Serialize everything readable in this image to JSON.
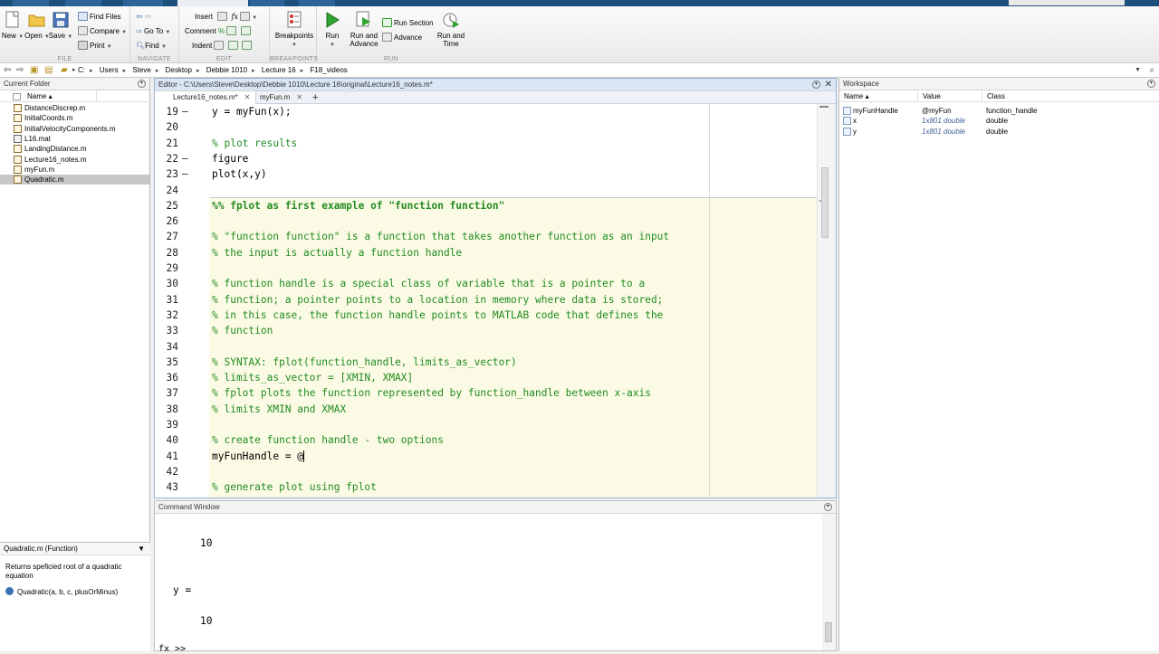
{
  "toolstrip": {
    "file": {
      "section_label": "FILE",
      "new_label": "New",
      "open_label": "Open",
      "save_label": "Save",
      "find_files_label": "Find Files",
      "compare_label": "Compare",
      "print_label": "Print"
    },
    "navigate": {
      "section_label": "NAVIGATE",
      "go_to_label": "Go To",
      "find_label": "Find"
    },
    "edit": {
      "section_label": "EDIT",
      "insert_label": "Insert",
      "comment_label": "Comment",
      "indent_label": "Indent",
      "fx_label": "fx"
    },
    "breakpoints": {
      "section_label": "BREAKPOINTS",
      "breakpoints_label": "Breakpoints"
    },
    "run": {
      "section_label": "RUN",
      "run_label": "Run",
      "run_and_advance_label": "Run and\nAdvance",
      "run_section_label": "Run Section",
      "advance_label": "Advance",
      "run_and_time_label": "Run and\nTime"
    }
  },
  "address_bar": {
    "crumbs": [
      "C:",
      "Users",
      "Steve",
      "Desktop",
      "Debbie 1010",
      "Lecture 16",
      "F18_videos"
    ]
  },
  "current_folder": {
    "title": "Current Folder",
    "column_name": "Name ▴",
    "files": [
      {
        "name": "DistanceDiscrep.m",
        "kind": "m"
      },
      {
        "name": "InitialCoords.m",
        "kind": "m"
      },
      {
        "name": "InitialVelocityComponents.m",
        "kind": "m"
      },
      {
        "name": "L16.mat",
        "kind": "mat"
      },
      {
        "name": "LandingDistance.m",
        "kind": "m"
      },
      {
        "name": "Lecture16_notes.m",
        "kind": "m"
      },
      {
        "name": "myFun.m",
        "kind": "m"
      },
      {
        "name": "Quadratic.m",
        "kind": "m",
        "selected": true
      }
    ],
    "details": {
      "header": "Quadratic.m  (Function)",
      "description": "Returns speficied root of a quadratic equation",
      "signature": "Quadratic(a, b, c, plusOrMinus)"
    }
  },
  "editor": {
    "title": "Editor - C:\\Users\\Steve\\Desktop\\Debbie 1010\\Lecture 16\\original\\Lecture16_notes.m*",
    "tabs": [
      {
        "label": "Lecture16_notes.m*",
        "active": true
      },
      {
        "label": "myFun.m",
        "active": false
      }
    ],
    "add_tab_label": "+",
    "lines": [
      {
        "num": "19",
        "dash": "—",
        "text": "y = myFun(x);",
        "kind": "code"
      },
      {
        "num": "20",
        "dash": "",
        "text": "",
        "kind": "code"
      },
      {
        "num": "21",
        "dash": "",
        "text": "% plot results",
        "kind": "comment"
      },
      {
        "num": "22",
        "dash": "—",
        "text": "figure",
        "kind": "code"
      },
      {
        "num": "23",
        "dash": "—",
        "text": "plot(x,y)",
        "kind": "code"
      },
      {
        "num": "24",
        "dash": "",
        "text": "",
        "kind": "code"
      },
      {
        "num": "25",
        "dash": "",
        "text": "%% fplot as first example of \"function function\"",
        "kind": "cell"
      },
      {
        "num": "26",
        "dash": "",
        "text": "",
        "kind": "code"
      },
      {
        "num": "27",
        "dash": "",
        "text": "% \"function function\" is a function that takes another function as an input",
        "kind": "comment"
      },
      {
        "num": "28",
        "dash": "",
        "text": "% the input is actually a function handle",
        "kind": "comment"
      },
      {
        "num": "29",
        "dash": "",
        "text": "",
        "kind": "code"
      },
      {
        "num": "30",
        "dash": "",
        "text": "% function handle is a special class of variable that is a pointer to a",
        "kind": "comment"
      },
      {
        "num": "31",
        "dash": "",
        "text": "% function; a pointer points to a location in memory where data is stored;",
        "kind": "comment"
      },
      {
        "num": "32",
        "dash": "",
        "text": "% in this case, the function handle points to MATLAB code that defines the",
        "kind": "comment"
      },
      {
        "num": "33",
        "dash": "",
        "text": "% function",
        "kind": "comment"
      },
      {
        "num": "34",
        "dash": "",
        "text": "",
        "kind": "code"
      },
      {
        "num": "35",
        "dash": "",
        "text": "% SYNTAX: fplot(function_handle, limits_as_vector)",
        "kind": "comment"
      },
      {
        "num": "36",
        "dash": "",
        "text": "% limits_as_vector = [XMIN, XMAX]",
        "kind": "comment"
      },
      {
        "num": "37",
        "dash": "",
        "text": "% fplot plots the function represented by function_handle between x-axis",
        "kind": "comment"
      },
      {
        "num": "38",
        "dash": "",
        "text": "% limits XMIN and XMAX",
        "kind": "comment"
      },
      {
        "num": "39",
        "dash": "",
        "text": "",
        "kind": "code"
      },
      {
        "num": "40",
        "dash": "",
        "text": "% create function handle - two options",
        "kind": "comment"
      },
      {
        "num": "41",
        "dash": "",
        "text": "myFunHandle = @",
        "kind": "code",
        "cursor": true
      },
      {
        "num": "42",
        "dash": "",
        "text": "",
        "kind": "code"
      },
      {
        "num": "43",
        "dash": "",
        "text": "% generate plot using fplot",
        "kind": "comment"
      }
    ]
  },
  "command_window": {
    "title": "Command Window",
    "lines": [
      "10",
      "y =",
      "10",
      "fx >>"
    ]
  },
  "workspace": {
    "title": "Workspace",
    "columns": [
      "Name ▴",
      "Value",
      "Class"
    ],
    "rows": [
      {
        "name": "myFunHandle",
        "value": "@myFun",
        "class": "function_handle",
        "italic": false
      },
      {
        "name": "x",
        "value": "1x801 double",
        "class": "double",
        "italic": true
      },
      {
        "name": "y",
        "value": "1x801 double",
        "class": "double",
        "italic": true
      }
    ]
  }
}
